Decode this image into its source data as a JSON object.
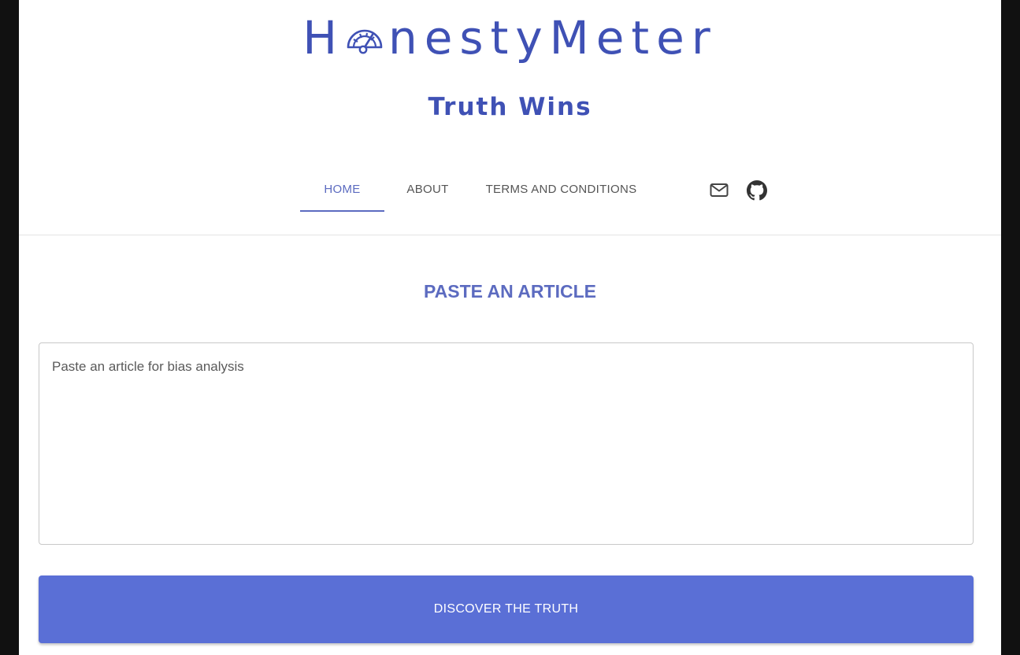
{
  "brand": {
    "logo_prefix": "H",
    "logo_suffix": "nestyMeter",
    "logo_icon": "gauge-icon",
    "tagline": "Truth Wins",
    "color": "#3f51b5"
  },
  "nav": {
    "tabs": [
      {
        "label": "HOME",
        "active": true
      },
      {
        "label": "ABOUT",
        "active": false
      },
      {
        "label": "TERMS AND CONDITIONS",
        "active": false
      }
    ],
    "icons": [
      "mail-icon",
      "github-icon"
    ],
    "accent": "#5c6bc0"
  },
  "main": {
    "title": "PASTE AN ARTICLE",
    "article_input": {
      "placeholder": "Paste an article for bias analysis",
      "value": ""
    },
    "submit_label": "DISCOVER THE TRUTH",
    "button_color": "#5a6fd6"
  }
}
